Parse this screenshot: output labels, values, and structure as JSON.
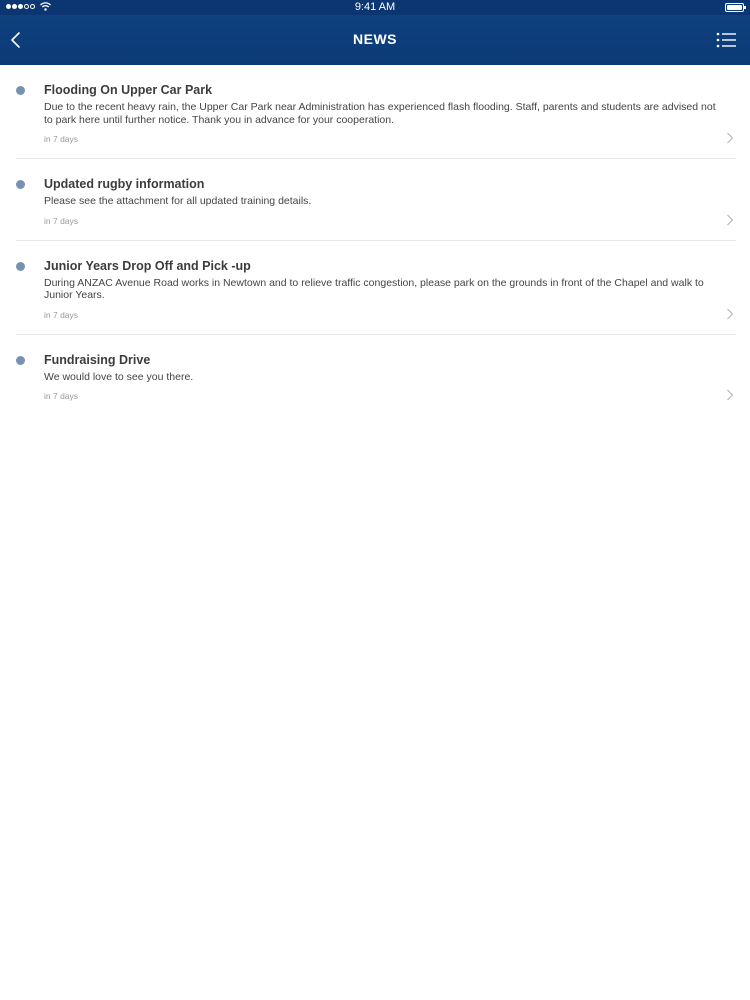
{
  "status": {
    "time": "9:41 AM"
  },
  "nav": {
    "title": "NEWS",
    "back_icon": "chevron-left-icon",
    "menu_icon": "list-menu-icon"
  },
  "news": [
    {
      "title": "Flooding On Upper Car Park",
      "body": "Due to the recent heavy rain, the Upper Car Park near Administration has experienced flash flooding. Staff, parents and students are advised not to park here until further notice. Thank you in advance for your cooperation.",
      "time": "in 7 days"
    },
    {
      "title": "Updated rugby information",
      "body": "Please see the attachment for all updated training details.",
      "time": "in 7 days"
    },
    {
      "title": "Junior Years Drop Off and Pick -up",
      "body": "During ANZAC Avenue Road works in Newtown and to relieve traffic congestion, please park on the grounds in front of the Chapel and walk to Junior Years.",
      "time": "in 7 days"
    },
    {
      "title": "Fundraising Drive",
      "body": "We would love to see you there.",
      "time": "in 7 days"
    }
  ],
  "colors": {
    "nav_background": "#0f4180",
    "bullet": "#7890b4"
  }
}
